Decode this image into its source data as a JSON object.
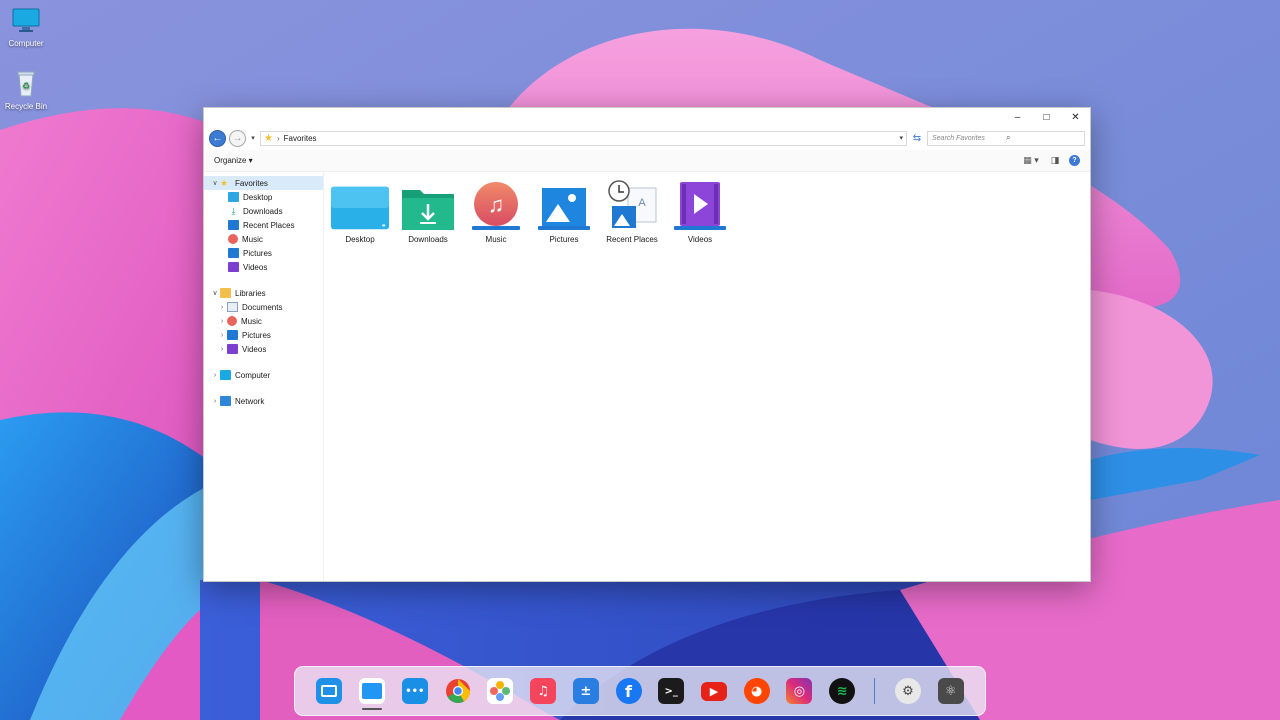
{
  "desktop": {
    "icons": [
      {
        "label": "Computer",
        "icon": "monitor-icon"
      },
      {
        "label": "Recycle Bin",
        "icon": "recycle-bin-icon"
      }
    ]
  },
  "window": {
    "controls": {
      "minimize": "–",
      "maximize": "□",
      "close": "✕"
    },
    "address": {
      "back": "←",
      "forward": "→",
      "separator": "›",
      "path": "Favorites",
      "dropdown": "▾",
      "refresh": "⇆",
      "search_placeholder": "Search Favorites",
      "search_glyph": "⌕"
    },
    "command_bar": {
      "organize": "Organize ▾",
      "view_glyph": "▦ ▾",
      "pane_glyph": "◨",
      "help": "?"
    },
    "nav": {
      "favorites": {
        "label": "Favorites",
        "items": [
          "Desktop",
          "Downloads",
          "Recent Places",
          "Music",
          "Pictures",
          "Videos"
        ]
      },
      "libraries": {
        "label": "Libraries",
        "items": [
          "Documents",
          "Music",
          "Pictures",
          "Videos"
        ]
      },
      "computer": "Computer",
      "network": "Network",
      "chevron_open": "∨",
      "chevron_closed": "›"
    },
    "content": {
      "items": [
        {
          "label": "Desktop",
          "icon": "desktop-folder-icon"
        },
        {
          "label": "Downloads",
          "icon": "downloads-folder-icon"
        },
        {
          "label": "Music",
          "icon": "music-folder-icon"
        },
        {
          "label": "Pictures",
          "icon": "pictures-folder-icon"
        },
        {
          "label": "Recent Places",
          "icon": "recent-places-icon"
        },
        {
          "label": "Videos",
          "icon": "videos-folder-icon"
        }
      ]
    }
  },
  "dock": {
    "apps": [
      {
        "name": "finder",
        "glyph": "",
        "color": "#1e90e8"
      },
      {
        "name": "file-explorer",
        "glyph": "",
        "color": "#2196f3",
        "running": true
      },
      {
        "name": "dots-app",
        "glyph": "•••",
        "color": "#1a8fe6"
      },
      {
        "name": "chrome",
        "glyph": "",
        "color": "#ffffff"
      },
      {
        "name": "photos",
        "glyph": "✿",
        "color": "#f3a33a"
      },
      {
        "name": "apple-music",
        "glyph": "♫",
        "color": "#f5455c"
      },
      {
        "name": "calculator",
        "glyph": "±",
        "color": "#2a7de1"
      },
      {
        "name": "facebook",
        "glyph": "f",
        "color": "#1877f2"
      },
      {
        "name": "terminal",
        "glyph": ">_",
        "color": "#1b1b1b"
      },
      {
        "name": "youtube",
        "glyph": "▶",
        "color": "#e62117"
      },
      {
        "name": "reddit",
        "glyph": "◕",
        "color": "#ff4500"
      },
      {
        "name": "instagram",
        "glyph": "◎",
        "color": "#d62976"
      },
      {
        "name": "spotify",
        "glyph": "≋",
        "color": "#1db954"
      },
      {
        "name": "settings",
        "glyph": "⚙",
        "color": "#e8e8e8"
      },
      {
        "name": "react-app",
        "glyph": "⚛",
        "color": "#4a4a4a"
      }
    ]
  }
}
